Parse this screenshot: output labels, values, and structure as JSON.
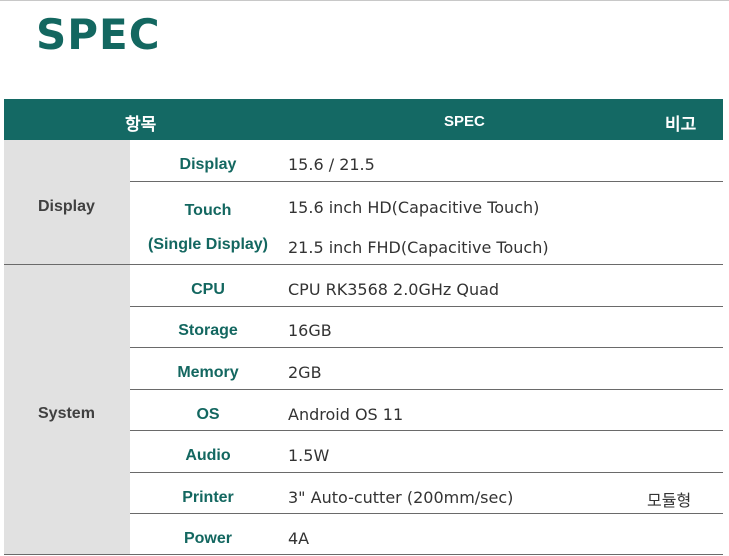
{
  "title": "SPEC",
  "header": {
    "item": "항목",
    "spec": "SPEC",
    "note": "비고"
  },
  "groups": [
    {
      "name": "Display"
    },
    {
      "name": "System"
    }
  ],
  "display": {
    "display": {
      "label": "Display",
      "value": "15.6 / 21.5"
    },
    "touch": {
      "label_line1": "Touch",
      "label_line2": "(Single Display)",
      "value_line1": "15.6 inch HD(Capacitive Touch)",
      "value_line2": "21.5 inch FHD(Capacitive Touch)"
    }
  },
  "system": [
    {
      "label": "CPU",
      "value": "CPU RK3568 2.0GHz Quad",
      "note": ""
    },
    {
      "label": "Storage",
      "value": "16GB",
      "note": ""
    },
    {
      "label": "Memory",
      "value": "2GB",
      "note": ""
    },
    {
      "label": "OS",
      "value": "Android OS 11",
      "note": ""
    },
    {
      "label": "Audio",
      "value": "1.5W",
      "note": ""
    },
    {
      "label": "Printer",
      "value": "3\" Auto-cutter (200mm/sec)",
      "note": "모듈형"
    },
    {
      "label": "Power",
      "value": "4A",
      "note": ""
    }
  ],
  "colors": {
    "accent": "#146964",
    "group_bg": "#e1e1e1"
  }
}
